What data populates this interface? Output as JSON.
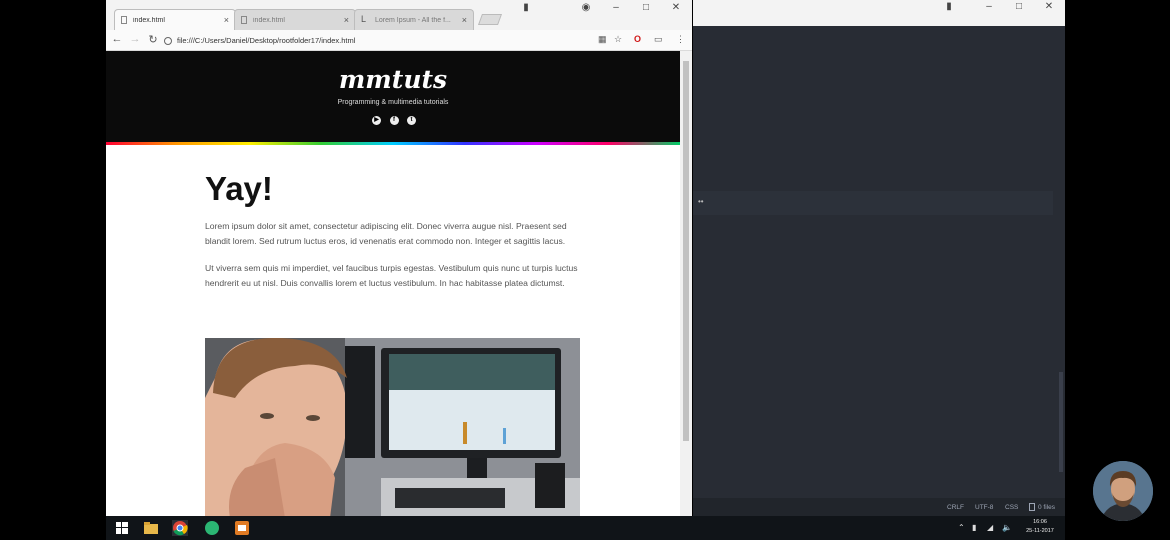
{
  "browser": {
    "tabs": [
      {
        "label": "index.html",
        "active": true
      },
      {
        "label": "index.html",
        "active": false
      },
      {
        "label": "Lorem Ipsum - All the f...",
        "active": false
      }
    ],
    "address": "file:///C:/Users/Daniel/Desktop/rootfolder17/index.html"
  },
  "site": {
    "logo": "mmtuts",
    "tagline": "Programming & multimedia tutorials",
    "social": [
      "youtube-icon",
      "facebook-icon",
      "twitter-icon"
    ]
  },
  "article": {
    "heading": "Yay!",
    "paragraphs": [
      "Lorem ipsum dolor sit amet, consectetur adipiscing elit. Donec viverra augue nisl. Praesent sed blandit lorem. Sed rutrum luctus eros, id venenatis erat commodo non. Integer et sagittis lacus.",
      "Ut viverra sem quis mi imperdiet, vel faucibus turpis egestas. Vestibulum quis nunc ut turpis luctus hendrerit eu ut nisl. Duis convallis lorem et luctus vestibulum. In hac habitasse platea dictumst."
    ]
  },
  "editor": {
    "status": {
      "line_ending": "CRLF",
      "encoding": "UTF-8",
      "grammar": "CSS",
      "files": "0 files"
    }
  },
  "taskbar": {
    "clock_time": "16:06",
    "clock_date": "25-11-2017"
  },
  "colors": {
    "editor_bg": "#282c34",
    "site_header_bg": "#0b0b0b",
    "taskbar_bg": "#101418"
  }
}
